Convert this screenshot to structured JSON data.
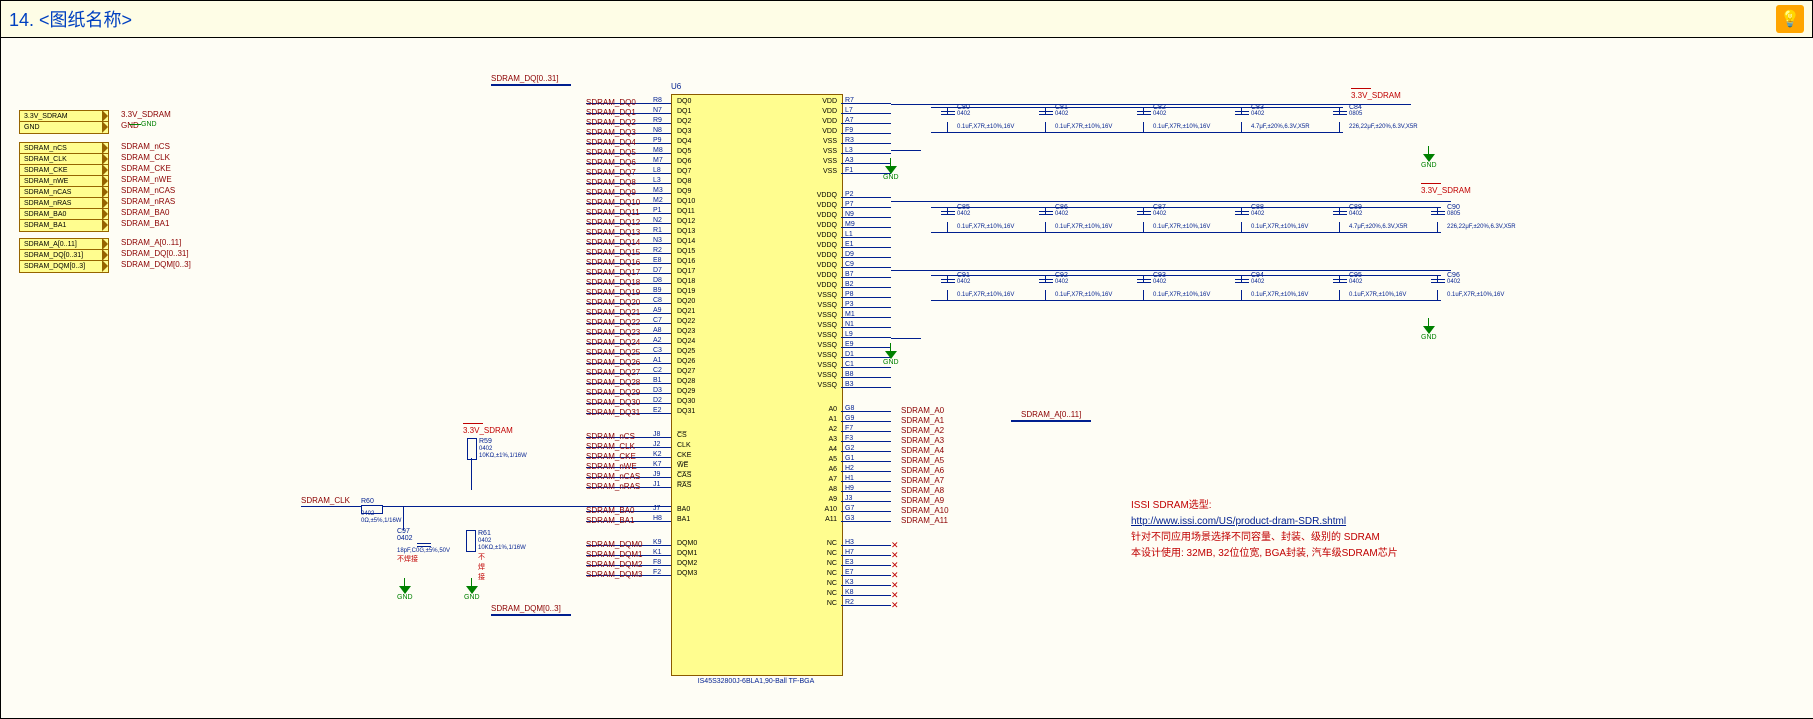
{
  "header": {
    "title": "14. <图纸名称>"
  },
  "ports_left": {
    "pwr": [
      "3.3V_SDRAM",
      "GND"
    ],
    "ctrl": [
      "SDRAM_nCS",
      "SDRAM_CLK",
      "SDRAM_CKE",
      "SDRAM_nWE",
      "SDRAM_nCAS",
      "SDRAM_nRAS",
      "SDRAM_BA0",
      "SDRAM_BA1"
    ],
    "bus": [
      "SDRAM_A[0..11]",
      "SDRAM_DQ[0..31]",
      "SDRAM_DQM[0..3]"
    ]
  },
  "labels_left": {
    "pwr": [
      "3.3V_SDRAM",
      "GND"
    ],
    "ctrl": [
      "SDRAM_nCS",
      "SDRAM_CLK",
      "SDRAM_CKE",
      "SDRAM_nWE",
      "SDRAM_nCAS",
      "SDRAM_nRAS",
      "SDRAM_BA0",
      "SDRAM_BA1"
    ],
    "bus": [
      "SDRAM_A[0..11]",
      "SDRAM_DQ[0..31]",
      "SDRAM_DQM[0..3]"
    ]
  },
  "chip": {
    "ref": "U6",
    "part": "IS45S32800J-6BLA1,90-Ball TF-BGA",
    "left": [
      {
        "pin": "R8",
        "name": "DQ0",
        "net": "SDRAM_DQ0"
      },
      {
        "pin": "N7",
        "name": "DQ1",
        "net": "SDRAM_DQ1"
      },
      {
        "pin": "R9",
        "name": "DQ2",
        "net": "SDRAM_DQ2"
      },
      {
        "pin": "N8",
        "name": "DQ3",
        "net": "SDRAM_DQ3"
      },
      {
        "pin": "P9",
        "name": "DQ4",
        "net": "SDRAM_DQ4"
      },
      {
        "pin": "M8",
        "name": "DQ5",
        "net": "SDRAM_DQ5"
      },
      {
        "pin": "M7",
        "name": "DQ6",
        "net": "SDRAM_DQ6"
      },
      {
        "pin": "L8",
        "name": "DQ7",
        "net": "SDRAM_DQ7"
      },
      {
        "pin": "L3",
        "name": "DQ8",
        "net": "SDRAM_DQ8"
      },
      {
        "pin": "M3",
        "name": "DQ9",
        "net": "SDRAM_DQ9"
      },
      {
        "pin": "M2",
        "name": "DQ10",
        "net": "SDRAM_DQ10"
      },
      {
        "pin": "P1",
        "name": "DQ11",
        "net": "SDRAM_DQ11"
      },
      {
        "pin": "N2",
        "name": "DQ12",
        "net": "SDRAM_DQ12"
      },
      {
        "pin": "R1",
        "name": "DQ13",
        "net": "SDRAM_DQ13"
      },
      {
        "pin": "N3",
        "name": "DQ14",
        "net": "SDRAM_DQ14"
      },
      {
        "pin": "R2",
        "name": "DQ15",
        "net": "SDRAM_DQ15"
      },
      {
        "pin": "E8",
        "name": "DQ16",
        "net": "SDRAM_DQ16"
      },
      {
        "pin": "D7",
        "name": "DQ17",
        "net": "SDRAM_DQ17"
      },
      {
        "pin": "D8",
        "name": "DQ18",
        "net": "SDRAM_DQ18"
      },
      {
        "pin": "B9",
        "name": "DQ19",
        "net": "SDRAM_DQ19"
      },
      {
        "pin": "C8",
        "name": "DQ20",
        "net": "SDRAM_DQ20"
      },
      {
        "pin": "A9",
        "name": "DQ21",
        "net": "SDRAM_DQ21"
      },
      {
        "pin": "C7",
        "name": "DQ22",
        "net": "SDRAM_DQ22"
      },
      {
        "pin": "A8",
        "name": "DQ23",
        "net": "SDRAM_DQ23"
      },
      {
        "pin": "A2",
        "name": "DQ24",
        "net": "SDRAM_DQ24"
      },
      {
        "pin": "C3",
        "name": "DQ25",
        "net": "SDRAM_DQ25"
      },
      {
        "pin": "A1",
        "name": "DQ26",
        "net": "SDRAM_DQ26"
      },
      {
        "pin": "C2",
        "name": "DQ27",
        "net": "SDRAM_DQ27"
      },
      {
        "pin": "B1",
        "name": "DQ28",
        "net": "SDRAM_DQ28"
      },
      {
        "pin": "D3",
        "name": "DQ29",
        "net": "SDRAM_DQ29"
      },
      {
        "pin": "D2",
        "name": "DQ30",
        "net": "SDRAM_DQ30"
      },
      {
        "pin": "E2",
        "name": "DQ31",
        "net": "SDRAM_DQ31"
      },
      {
        "pin": "J8",
        "name": "C̅S̅",
        "net": "SDRAM_nCS"
      },
      {
        "pin": "J2",
        "name": "CLK",
        "net": "SDRAM_CLK"
      },
      {
        "pin": "K2",
        "name": "CKE",
        "net": "SDRAM_CKE"
      },
      {
        "pin": "K7",
        "name": "W̅E̅",
        "net": "SDRAM_nWE"
      },
      {
        "pin": "J9",
        "name": "C̅A̅S̅",
        "net": "SDRAM_nCAS"
      },
      {
        "pin": "J1",
        "name": "R̅A̅S̅",
        "net": "SDRAM_nRAS"
      },
      {
        "pin": "J7",
        "name": "BA0",
        "net": "SDRAM_BA0"
      },
      {
        "pin": "H8",
        "name": "BA1",
        "net": "SDRAM_BA1"
      },
      {
        "pin": "K9",
        "name": "DQM0",
        "net": "SDRAM_DQM0"
      },
      {
        "pin": "K1",
        "name": "DQM1",
        "net": "SDRAM_DQM1"
      },
      {
        "pin": "F8",
        "name": "DQM2",
        "net": "SDRAM_DQM2"
      },
      {
        "pin": "F2",
        "name": "DQM3",
        "net": "SDRAM_DQM3"
      }
    ],
    "right": [
      {
        "pin": "R7",
        "name": "VDD"
      },
      {
        "pin": "L7",
        "name": "VDD"
      },
      {
        "pin": "A7",
        "name": "VDD"
      },
      {
        "pin": "F9",
        "name": "VDD"
      },
      {
        "pin": "R3",
        "name": "VSS"
      },
      {
        "pin": "L3",
        "name": "VSS"
      },
      {
        "pin": "A3",
        "name": "VSS"
      },
      {
        "pin": "F1",
        "name": "VSS"
      },
      {
        "pin": "P2",
        "name": "VDDQ"
      },
      {
        "pin": "P7",
        "name": "VDDQ"
      },
      {
        "pin": "N9",
        "name": "VDDQ"
      },
      {
        "pin": "M9",
        "name": "VDDQ"
      },
      {
        "pin": "L1",
        "name": "VDDQ"
      },
      {
        "pin": "E1",
        "name": "VDDQ"
      },
      {
        "pin": "D9",
        "name": "VDDQ"
      },
      {
        "pin": "C9",
        "name": "VDDQ"
      },
      {
        "pin": "B7",
        "name": "VDDQ"
      },
      {
        "pin": "B2",
        "name": "VDDQ"
      },
      {
        "pin": "P8",
        "name": "VSSQ"
      },
      {
        "pin": "P3",
        "name": "VSSQ"
      },
      {
        "pin": "M1",
        "name": "VSSQ"
      },
      {
        "pin": "N1",
        "name": "VSSQ"
      },
      {
        "pin": "L9",
        "name": "VSSQ"
      },
      {
        "pin": "E9",
        "name": "VSSQ"
      },
      {
        "pin": "D1",
        "name": "VSSQ"
      },
      {
        "pin": "C1",
        "name": "VSSQ"
      },
      {
        "pin": "B8",
        "name": "VSSQ"
      },
      {
        "pin": "B3",
        "name": "VSSQ"
      },
      {
        "pin": "G8",
        "name": "A0",
        "net": "SDRAM_A0"
      },
      {
        "pin": "G9",
        "name": "A1",
        "net": "SDRAM_A1"
      },
      {
        "pin": "F7",
        "name": "A2",
        "net": "SDRAM_A2"
      },
      {
        "pin": "F3",
        "name": "A3",
        "net": "SDRAM_A3"
      },
      {
        "pin": "G2",
        "name": "A4",
        "net": "SDRAM_A4"
      },
      {
        "pin": "G1",
        "name": "A5",
        "net": "SDRAM_A5"
      },
      {
        "pin": "H2",
        "name": "A6",
        "net": "SDRAM_A6"
      },
      {
        "pin": "H1",
        "name": "A7",
        "net": "SDRAM_A7"
      },
      {
        "pin": "H9",
        "name": "A8",
        "net": "SDRAM_A8"
      },
      {
        "pin": "J3",
        "name": "A9",
        "net": "SDRAM_A9"
      },
      {
        "pin": "G7",
        "name": "A10",
        "net": "SDRAM_A10"
      },
      {
        "pin": "G3",
        "name": "A11",
        "net": "SDRAM_A11"
      },
      {
        "pin": "H3",
        "name": "NC"
      },
      {
        "pin": "H7",
        "name": "NC"
      },
      {
        "pin": "E3",
        "name": "NC"
      },
      {
        "pin": "E7",
        "name": "NC"
      },
      {
        "pin": "K3",
        "name": "NC"
      },
      {
        "pin": "K8",
        "name": "NC"
      },
      {
        "pin": "R2",
        "name": "NC"
      }
    ]
  },
  "caps_row1": [
    {
      "ref": "C80",
      "pkg": "0402",
      "val": "0.1uF,X7R,±10%,16V"
    },
    {
      "ref": "C81",
      "pkg": "0402",
      "val": "0.1uF,X7R,±10%,16V"
    },
    {
      "ref": "C82",
      "pkg": "0402",
      "val": "0.1uF,X7R,±10%,16V"
    },
    {
      "ref": "C83",
      "pkg": "0402",
      "val": "4.7μF,±20%,6.3V,X5R"
    },
    {
      "ref": "C84",
      "pkg": "0805",
      "val": "226,22μF,±20%,6.3V,X5R"
    }
  ],
  "caps_row2": [
    {
      "ref": "C85",
      "pkg": "0402",
      "val": "0.1uF,X7R,±10%,16V"
    },
    {
      "ref": "C86",
      "pkg": "0402",
      "val": "0.1uF,X7R,±10%,16V"
    },
    {
      "ref": "C87",
      "pkg": "0402",
      "val": "0.1uF,X7R,±10%,16V"
    },
    {
      "ref": "C88",
      "pkg": "0402",
      "val": "0.1uF,X7R,±10%,16V"
    },
    {
      "ref": "C89",
      "pkg": "0402",
      "val": "4.7μF,±20%,6.3V,X5R"
    },
    {
      "ref": "C90",
      "pkg": "0805",
      "val": "226,22μF,±20%,6.3V,X5R"
    }
  ],
  "caps_row3": [
    {
      "ref": "C91",
      "pkg": "0402",
      "val": "0.1uF,X7R,±10%,16V"
    },
    {
      "ref": "C92",
      "pkg": "0402",
      "val": "0.1uF,X7R,±10%,16V"
    },
    {
      "ref": "C93",
      "pkg": "0402",
      "val": "0.1uF,X7R,±10%,16V"
    },
    {
      "ref": "C94",
      "pkg": "0402",
      "val": "0.1uF,X7R,±10%,16V"
    },
    {
      "ref": "C95",
      "pkg": "0402",
      "val": "0.1uF,X7R,±10%,16V"
    },
    {
      "ref": "C96",
      "pkg": "0402",
      "val": "0.1uF,X7R,±10%,16V"
    }
  ],
  "res": {
    "R59": {
      "ref": "R59",
      "pkg": "0402",
      "val": "10KΩ,±1%,1/16W"
    },
    "R60": {
      "ref": "R60",
      "pkg": "0402",
      "val": "0Ω,±5%,1/16W"
    },
    "R61": {
      "ref": "R61",
      "pkg": "0402",
      "val": "10KΩ,±1%,1/16W"
    },
    "C97": {
      "ref": "C97",
      "pkg": "0402",
      "val": "18pF,C0G,±5%,50V"
    }
  },
  "addr_bus": "SDRAM_A[0..11]",
  "dq_bus": "SDRAM_DQ[0..31]",
  "dqm_bus": "SDRAM_DQM[0..3]",
  "clk_net": "SDRAM_CLK",
  "pwr_main": "3.3V_SDRAM",
  "gnd": "GND",
  "no_weld": "不焊接",
  "info": {
    "l1": "ISSI SDRAM选型:",
    "l2": "http://www.issi.com/US/product-dram-SDR.shtml",
    "l3": "针对不同应用场景选择不同容量、封装、级别的 SDRAM",
    "l4": "本设计使用: 32MB, 32位位宽, BGA封装, 汽车级SDRAM芯片"
  }
}
